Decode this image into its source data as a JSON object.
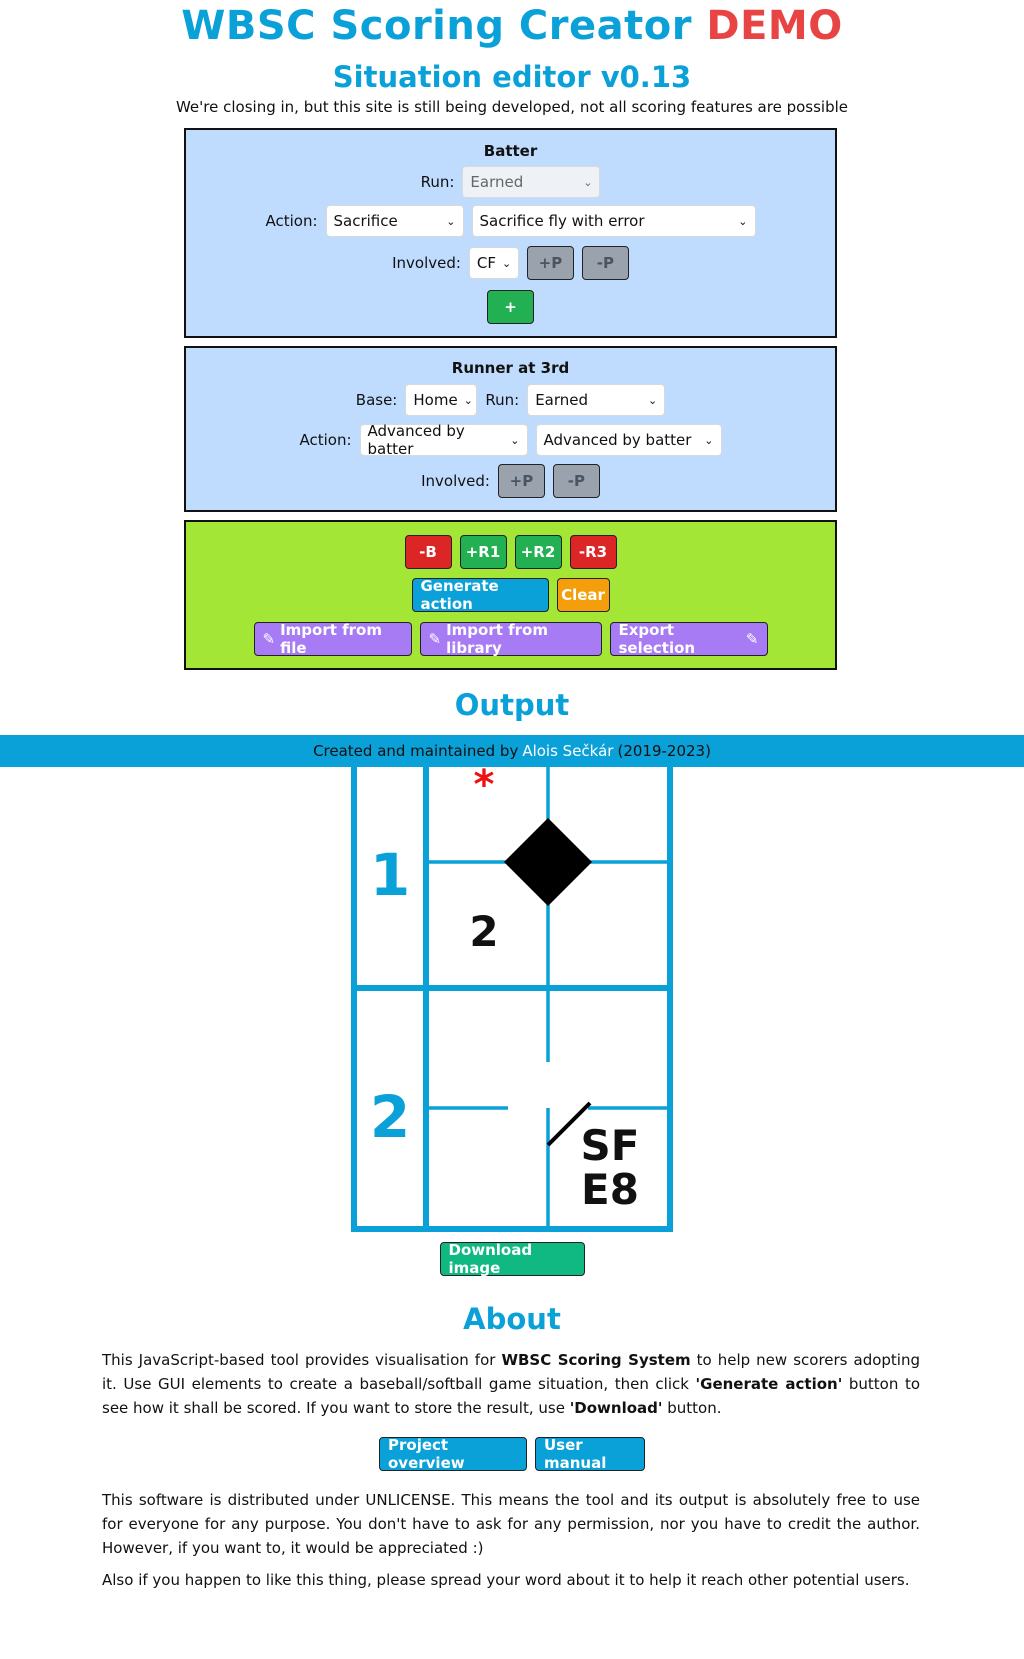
{
  "header": {
    "title": "WBSC Scoring Creator",
    "demo": "DEMO",
    "subtitle": "Situation editor v0.13",
    "notice": "We're closing in, but this site is still being developed, not all scoring features are possible"
  },
  "batter": {
    "title": "Batter",
    "run_label": "Run:",
    "run_value": "Earned",
    "action_label": "Action:",
    "action_value": "Sacrifice",
    "action_detail": "Sacrifice fly with error",
    "involved_label": "Involved:",
    "involved_value": "CF",
    "plus_p": "+P",
    "minus_p": "-P",
    "add": "+"
  },
  "runner3": {
    "title": "Runner at 3rd",
    "base_label": "Base:",
    "base_value": "Home",
    "run_label": "Run:",
    "run_value": "Earned",
    "action_label": "Action:",
    "action_value": "Advanced by batter",
    "action_detail": "Advanced by batter",
    "involved_label": "Involved:",
    "plus_p": "+P",
    "minus_p": "-P"
  },
  "controls": {
    "minus_b": "-B",
    "plus_r1": "+R1",
    "plus_r2": "+R2",
    "minus_r3": "-R3",
    "generate": "Generate action",
    "clear": "Clear",
    "import_file": "Import from file",
    "import_library": "Import from library",
    "export_selection": "Export selection",
    "import_icon": "✎",
    "export_icon": "✎"
  },
  "output": {
    "title": "Output",
    "row1_number": "1",
    "row1_star": "*",
    "row1_value": "2",
    "row2_number": "2",
    "row2_code_line1": "SF",
    "row2_code_line2": "E8",
    "download": "Download image"
  },
  "footer": {
    "prefix": "Created and maintained by",
    "author": "Alois Sečkár",
    "years": "(2019-2023)"
  },
  "about": {
    "title": "About",
    "p1_a": "This JavaScript-based tool provides visualisation for ",
    "p1_b": "WBSC Scoring System",
    "p1_c": " to help new scorers adopting it. Use GUI elements to create a baseball/softball game situation, then click ",
    "p1_d": "'Generate action'",
    "p1_e": " button to see how it shall be scored. If you want to store the result, use ",
    "p1_f": "'Download'",
    "p1_g": " button.",
    "project_overview": "Project overview",
    "user_manual": "User manual",
    "p2": "This software is distributed under UNLICENSE. This means the tool and its output is absolutely free to use for everyone for any purpose. You don't have to ask for any permission, nor you have to credit the author. However, if you want to, it would be appreciated :)",
    "p3": "Also if you happen to like this thing, please spread your word about it to help it reach other potential users."
  },
  "colors": {
    "accent": "#0aa0d8",
    "demo": "#e84444",
    "panel_blue": "#bfdcff",
    "panel_green": "#a3e636"
  }
}
